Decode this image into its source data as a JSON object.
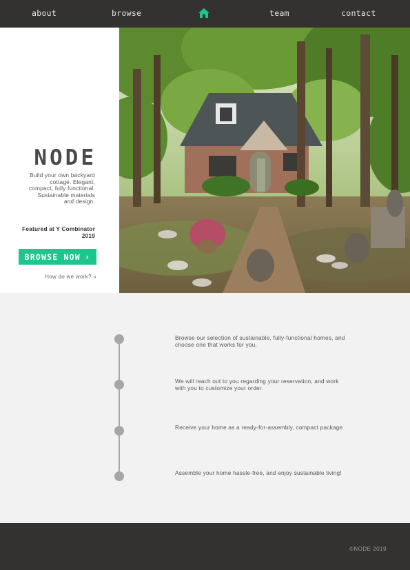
{
  "nav": {
    "items": [
      {
        "label": "about"
      },
      {
        "label": "browse"
      },
      {
        "label": "team"
      },
      {
        "label": "contact"
      }
    ],
    "home_icon": "home-icon",
    "accent_color": "#1dc58f"
  },
  "hero": {
    "brand": "NODE",
    "tagline": "Build your own backyard cottage. Elegant, compact, fully functional. Sustainable materials and design.",
    "featured": "Featured at Y Combinator 2019",
    "browse_button": "BROWSE NOW",
    "browse_icon": "chevron-right-icon",
    "how_link": "How do we work?",
    "how_icon": "double-chevron-down-icon",
    "photo": "cottage-in-woods-photo"
  },
  "steps": [
    {
      "text": "Browse our selection of sustainable, fully-functional homes, and choose one that works for you."
    },
    {
      "text": "We will reach out to you regarding your reservation, and work with you to customize your order."
    },
    {
      "text": "Receive your home as a ready-for-assembly, compact package"
    },
    {
      "text": "Assemble your home hassle-free, and enjoy sustainable living!"
    }
  ],
  "footer": {
    "copyright": "©NODE 2019"
  }
}
